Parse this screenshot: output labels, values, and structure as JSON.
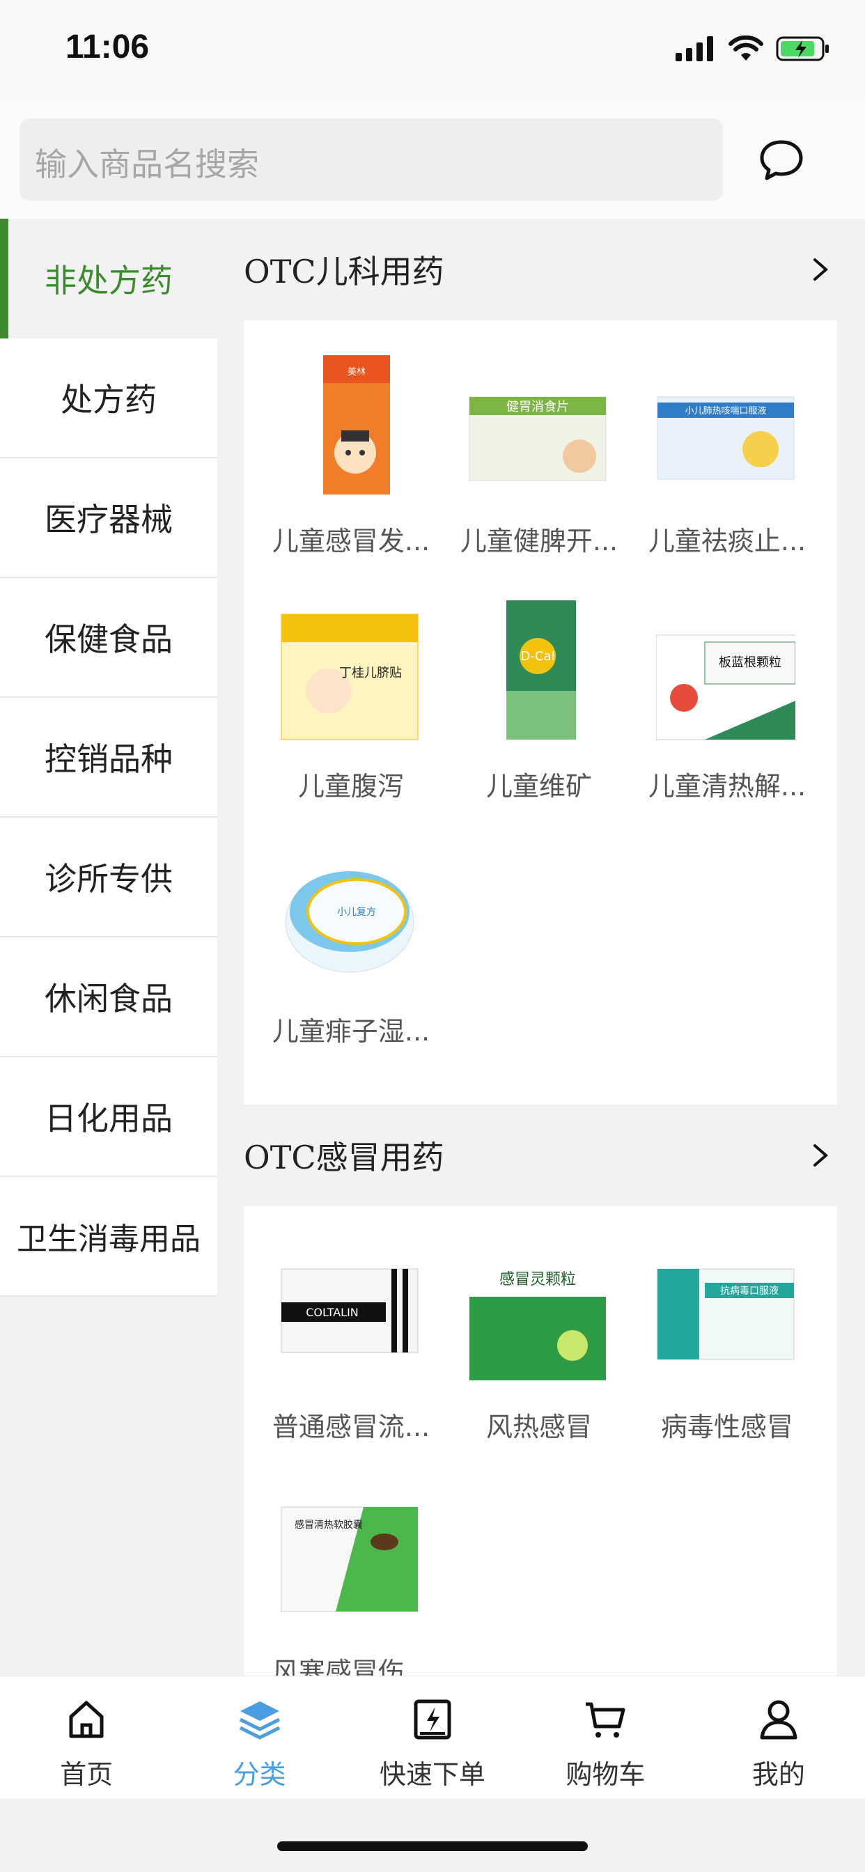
{
  "status_bar": {
    "time": "11:06"
  },
  "search": {
    "placeholder": "输入商品名搜索"
  },
  "sidebar": {
    "items": [
      {
        "label": "非处方药",
        "active": true
      },
      {
        "label": "处方药"
      },
      {
        "label": "医疗器械"
      },
      {
        "label": "保健食品"
      },
      {
        "label": "控销品种"
      },
      {
        "label": "诊所专供"
      },
      {
        "label": "休闲食品"
      },
      {
        "label": "日化用品"
      },
      {
        "label": "卫生消毒用品"
      }
    ]
  },
  "sections": [
    {
      "title": "OTC儿科用药",
      "products": [
        {
          "name": "儿童感冒发...",
          "box_text": "美林"
        },
        {
          "name": "儿童健脾开...",
          "box_text": "健胃消食片"
        },
        {
          "name": "儿童祛痰止...",
          "box_text": "小儿肺热咳喘口服液"
        },
        {
          "name": "儿童腹泻",
          "box_text": "丁桂儿脐贴"
        },
        {
          "name": "儿童维矿",
          "box_text": "D-Cal"
        },
        {
          "name": "儿童清热解...",
          "box_text": "板蓝根颗粒"
        },
        {
          "name": "儿童痱子湿...",
          "box_text": "小儿复方"
        }
      ]
    },
    {
      "title": "OTC感冒用药",
      "products": [
        {
          "name": "普通感冒流...",
          "box_text": "COLTALIN"
        },
        {
          "name": "风热感冒",
          "box_text": "感冒灵颗粒"
        },
        {
          "name": "病毒性感冒",
          "box_text": "抗病毒口服液"
        },
        {
          "name": "风寒感冒伤...",
          "box_text": "感冒清热软胶囊"
        }
      ]
    }
  ],
  "tab_bar": {
    "tabs": [
      {
        "label": "首页",
        "icon": "home-icon"
      },
      {
        "label": "分类",
        "icon": "layers-icon",
        "active": true
      },
      {
        "label": "快速下单",
        "icon": "quick-order-icon"
      },
      {
        "label": "购物车",
        "icon": "cart-icon"
      },
      {
        "label": "我的",
        "icon": "user-icon"
      }
    ]
  },
  "colors": {
    "accent_green": "#3c8a2e",
    "active_tab_blue": "#4a9de0"
  }
}
